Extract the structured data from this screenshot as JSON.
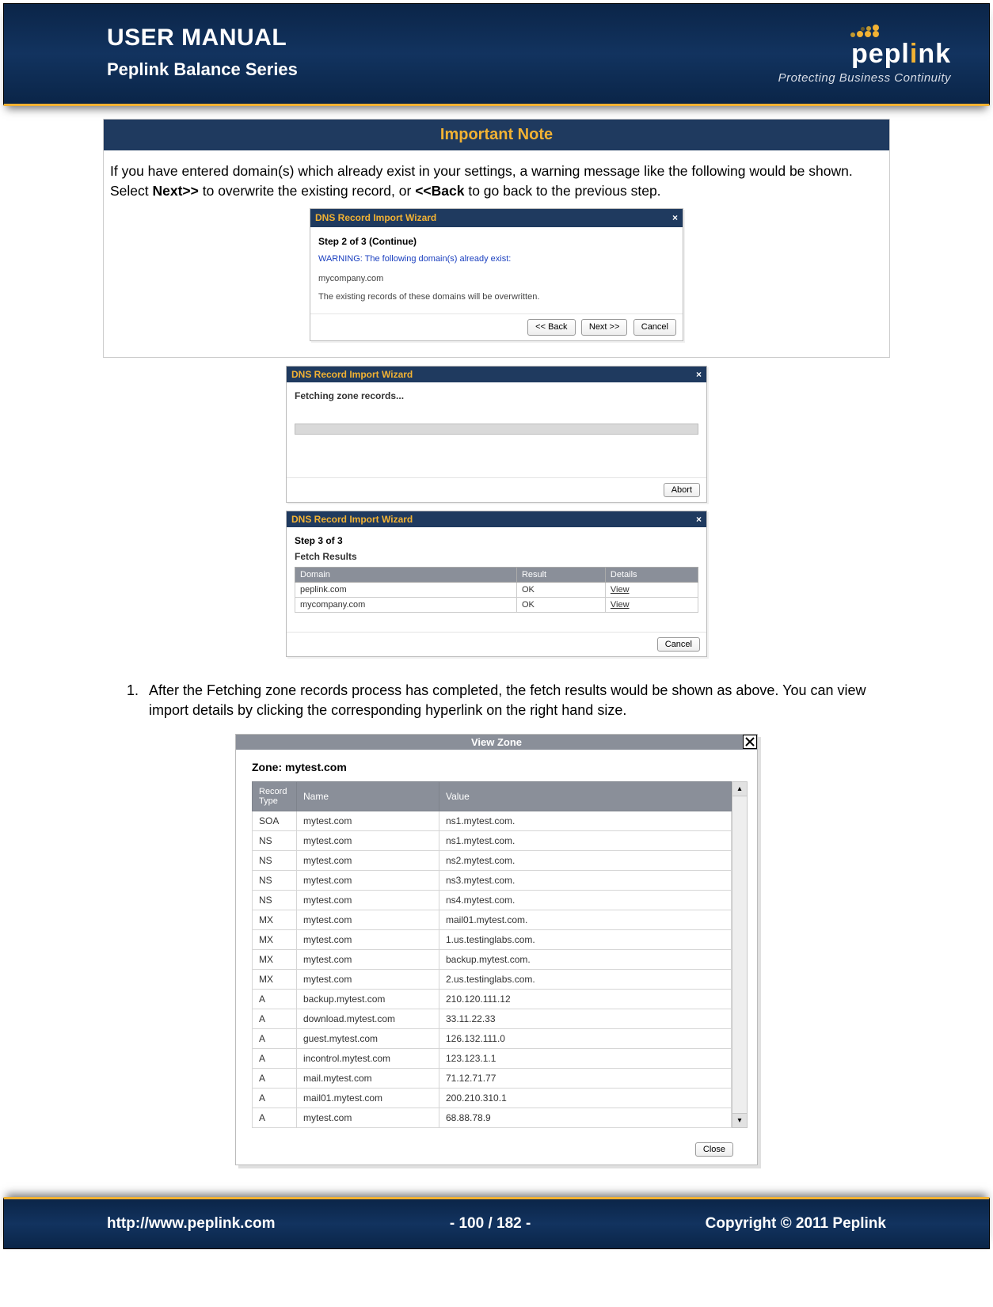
{
  "header": {
    "title": "USER MANUAL",
    "subtitle": "Peplink Balance Series",
    "brand": "peplink",
    "tagline": "Protecting Business Continuity"
  },
  "note": {
    "title": "Important Note",
    "body_before": "If you have entered domain(s) which already exist in your settings, a warning message like the following would be shown. Select ",
    "bold1": "Next>>",
    "body_mid": " to overwrite the existing record, or ",
    "bold2": "<<Back",
    "body_after": " to go back to the previous step."
  },
  "wizard1": {
    "title": "DNS Record Import Wizard",
    "close": "×",
    "step": "Step 2 of 3 (Continue)",
    "warn": "WARNING: The following domain(s) already exist:",
    "domain": "mycompany.com",
    "overwrite": "The existing records of these domains will be overwritten.",
    "back": "<< Back",
    "next": "Next >>",
    "cancel": "Cancel"
  },
  "wizard2": {
    "title": "DNS Record Import Wizard",
    "close": "×",
    "fetching": "Fetching zone records...",
    "abort": "Abort"
  },
  "wizard3": {
    "title": "DNS Record Import Wizard",
    "close": "×",
    "step": "Step 3 of 3",
    "sub": "Fetch Results",
    "cols": {
      "domain": "Domain",
      "result": "Result",
      "details": "Details"
    },
    "rows": [
      {
        "domain": "peplink.com",
        "result": "OK",
        "details": "View"
      },
      {
        "domain": "mycompany.com",
        "result": "OK",
        "details": "View"
      }
    ],
    "cancel": "Cancel"
  },
  "list": {
    "item1": "After the Fetching zone records process has completed, the fetch results would be shown as above. You can view import details by clicking the corresponding hyperlink on the right hand size."
  },
  "viewzone": {
    "title": "View Zone",
    "zone_label": "Zone: mytest.com",
    "cols": {
      "type": "Record Type",
      "name": "Name",
      "value": "Value"
    },
    "rows": [
      {
        "t": "SOA",
        "n": "mytest.com",
        "v": "ns1.mytest.com."
      },
      {
        "t": "NS",
        "n": "mytest.com",
        "v": "ns1.mytest.com."
      },
      {
        "t": "NS",
        "n": "mytest.com",
        "v": "ns2.mytest.com."
      },
      {
        "t": "NS",
        "n": "mytest.com",
        "v": "ns3.mytest.com."
      },
      {
        "t": "NS",
        "n": "mytest.com",
        "v": "ns4.mytest.com."
      },
      {
        "t": "MX",
        "n": "mytest.com",
        "v": "mail01.mytest.com."
      },
      {
        "t": "MX",
        "n": "mytest.com",
        "v": "1.us.testinglabs.com."
      },
      {
        "t": "MX",
        "n": "mytest.com",
        "v": "backup.mytest.com."
      },
      {
        "t": "MX",
        "n": "mytest.com",
        "v": "2.us.testinglabs.com."
      },
      {
        "t": "A",
        "n": "backup.mytest.com",
        "v": "210.120.111.12"
      },
      {
        "t": "A",
        "n": "download.mytest.com",
        "v": "33.11.22.33"
      },
      {
        "t": "A",
        "n": "guest.mytest.com",
        "v": "126.132.111.0"
      },
      {
        "t": "A",
        "n": "incontrol.mytest.com",
        "v": "123.123.1.1"
      },
      {
        "t": "A",
        "n": "mail.mytest.com",
        "v": "71.12.71.77"
      },
      {
        "t": "A",
        "n": "mail01.mytest.com",
        "v": "200.210.310.1"
      },
      {
        "t": "A",
        "n": "mytest.com",
        "v": "68.88.78.9"
      }
    ],
    "close": "Close"
  },
  "footer": {
    "url": "http://www.peplink.com",
    "page": "- 100 / 182 -",
    "copyright": "Copyright © 2011 Peplink"
  }
}
